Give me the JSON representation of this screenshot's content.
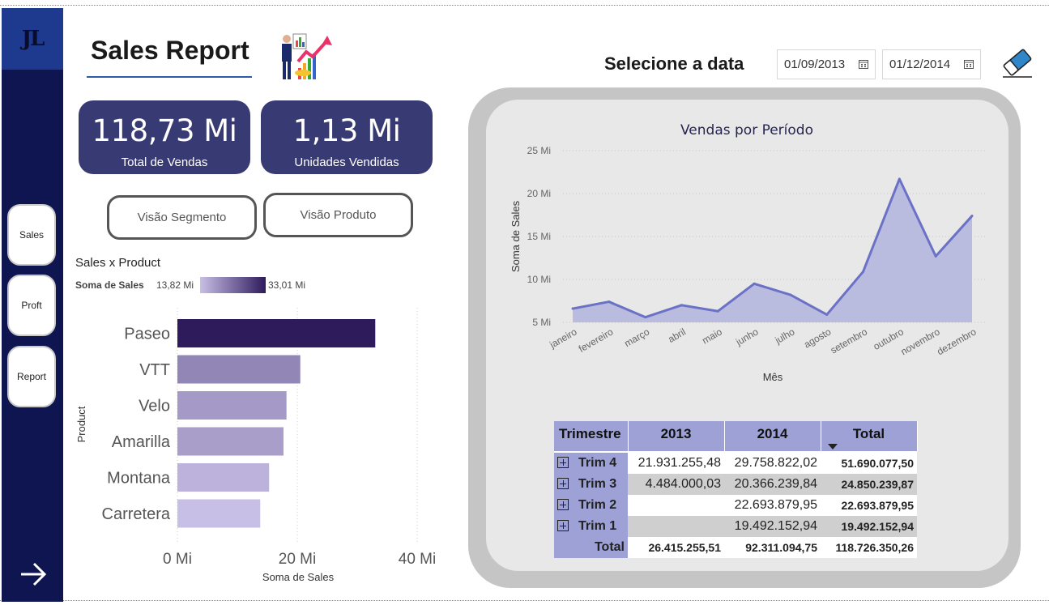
{
  "header": {
    "title": "Sales Report",
    "date_label": "Selecione a data",
    "date_start": "01/09/2013",
    "date_end": "01/12/2014"
  },
  "sidebar": {
    "logo": "JL",
    "items": [
      {
        "label": "Sales"
      },
      {
        "label": "Proft"
      },
      {
        "label": "Report"
      }
    ]
  },
  "kpis": [
    {
      "value": "118,73 Mi",
      "label": "Total de Vendas"
    },
    {
      "value": "1,13 Mi",
      "label": "Unidades Vendidas"
    }
  ],
  "views": {
    "segment": "Visão Segmento",
    "product": "Visão Produto"
  },
  "bar_chart": {
    "title": "Sales x Product",
    "legend_label": "Soma de Sales",
    "legend_min": "13,82 Mi",
    "legend_max": "33,01 Mi"
  },
  "colors": {
    "sidebar": "#0e1550",
    "kpi": "#383a73",
    "line": "#6b72c6",
    "area": "#b9bbdf",
    "table_header": "#9da1d6"
  },
  "chart_data": [
    {
      "type": "bar",
      "title": "Sales x Product",
      "categories": [
        "Paseo",
        "VTT",
        "Velo",
        "Amarilla",
        "Montana",
        "Carretera"
      ],
      "values": [
        33.01,
        20.5,
        18.2,
        17.7,
        15.3,
        13.82
      ],
      "xlabel": "Soma de Sales",
      "ylabel": "Product",
      "xlim": [
        0,
        40
      ],
      "xticks": [
        "0 Mi",
        "20 Mi",
        "40 Mi"
      ],
      "color_scale": [
        "#c8bfe6",
        "#2e1b5c"
      ]
    },
    {
      "type": "area",
      "title": "Vendas por Período",
      "categories": [
        "janeiro",
        "fevereiro",
        "março",
        "abril",
        "maio",
        "junho",
        "julho",
        "agosto",
        "setembro",
        "outubro",
        "novembro",
        "dezembro"
      ],
      "values": [
        6.6,
        7.4,
        5.6,
        7.0,
        6.3,
        9.5,
        8.2,
        5.9,
        10.9,
        21.7,
        12.7,
        17.4
      ],
      "xlabel": "Mês",
      "ylabel": "Soma de Sales",
      "ylim": [
        5,
        25
      ],
      "yticks": [
        "5 Mi",
        "10 Mi",
        "15 Mi",
        "20 Mi",
        "25 Mi"
      ]
    }
  ],
  "matrix": {
    "headers": [
      "Trimestre",
      "2013",
      "2014",
      "Total"
    ],
    "rows": [
      {
        "label": "Trim 4",
        "y2013": "21.931.255,48",
        "y2014": "29.758.822,02",
        "total": "51.690.077,50"
      },
      {
        "label": "Trim 3",
        "y2013": "4.484.000,03",
        "y2014": "20.366.239,84",
        "total": "24.850.239,87"
      },
      {
        "label": "Trim 2",
        "y2013": "",
        "y2014": "22.693.879,95",
        "total": "22.693.879,95"
      },
      {
        "label": "Trim 1",
        "y2013": "",
        "y2014": "19.492.152,94",
        "total": "19.492.152,94"
      }
    ],
    "total": {
      "label": "Total",
      "y2013": "26.415.255,51",
      "y2014": "92.311.094,75",
      "total": "118.726.350,26"
    }
  }
}
